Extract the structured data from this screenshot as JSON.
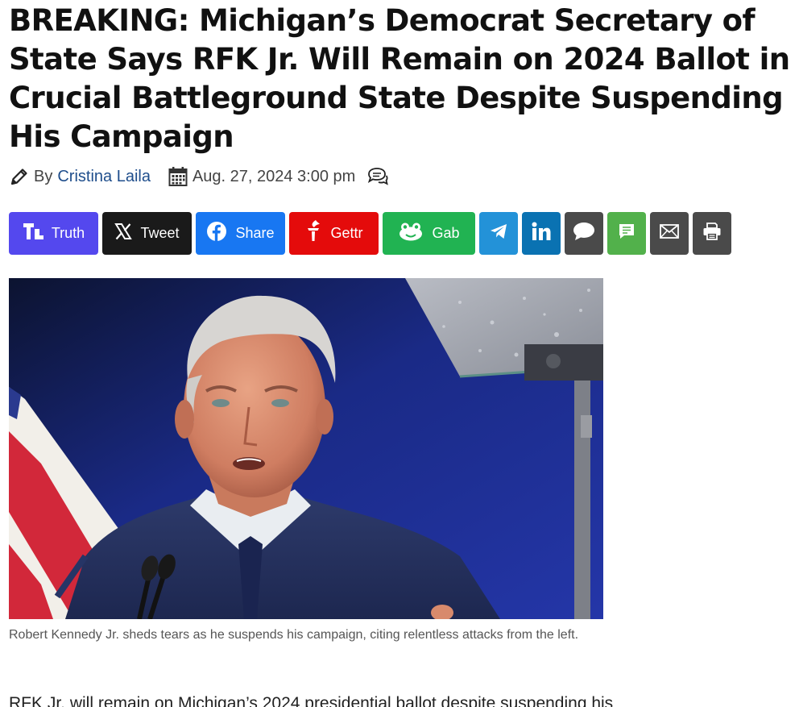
{
  "article": {
    "headline": "BREAKING: Michigan’s Democrat Secretary of State Says RFK Jr. Will Remain on 2024 Ballot in Crucial Battleground State Despite Suspending His Campaign",
    "byline": {
      "by_label": "By",
      "author": "Cristina Laila",
      "date": "Aug. 27, 2024 3:00 pm"
    },
    "caption": "Robert Kennedy Jr. sheds tears as he suspends his campaign, citing relentless attacks from the left.",
    "body_first_line": "RFK Jr. will remain on Michigan’s 2024 presidential ballot despite suspending his"
  },
  "share": {
    "buttons": [
      {
        "label": "Truth",
        "icon": "truth-social-icon",
        "color": "#5448ee"
      },
      {
        "label": "Tweet",
        "icon": "x-icon",
        "color": "#1a1a1a"
      },
      {
        "label": "Share",
        "icon": "facebook-icon",
        "color": "#1877f2"
      },
      {
        "label": "Gettr",
        "icon": "gettr-icon",
        "color": "#e40b0b"
      },
      {
        "label": "Gab",
        "icon": "gab-icon",
        "color": "#21b352"
      }
    ],
    "icon_buttons": [
      {
        "icon": "telegram-icon",
        "color": "#2392d8"
      },
      {
        "icon": "linkedin-icon",
        "color": "#0a72b2"
      },
      {
        "icon": "comment-bubble-icon",
        "color": "#4a4a4a"
      },
      {
        "icon": "sms-icon",
        "color": "#52b14b"
      },
      {
        "icon": "email-icon",
        "color": "#4a4a4a"
      },
      {
        "icon": "print-icon",
        "color": "#4a4a4a"
      }
    ]
  }
}
